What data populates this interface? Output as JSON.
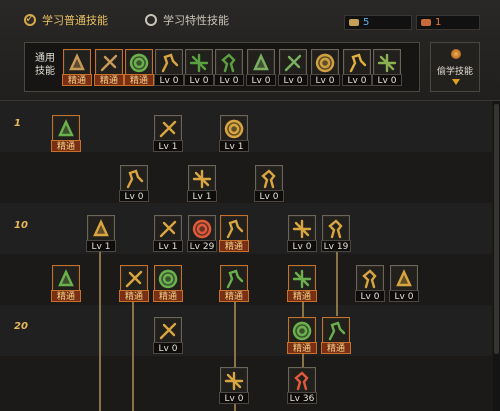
{
  "tabs": {
    "normal_label": "学习普通技能",
    "trait_label": "学习特性技能"
  },
  "counters": [
    {
      "value": "5",
      "color": "#5ab4e8",
      "icon_color": "#c4a05a",
      "icon": "sp-book-icon"
    },
    {
      "value": "1",
      "color": "#e87a3a",
      "icon_color": "#c86a3a",
      "icon": "tp-book-icon"
    }
  ],
  "general": {
    "label": "通用\n技能",
    "slots": [
      {
        "icon": "sit-icon",
        "tag": "精通",
        "mastered": true,
        "color": "#c89a58"
      },
      {
        "icon": "leap-icon",
        "tag": "精通",
        "mastered": true,
        "color": "#c89a58"
      },
      {
        "icon": "sprint-icon",
        "tag": "精通",
        "mastered": true,
        "color": "#6ab04c"
      },
      {
        "icon": "wings-icon",
        "tag": "Lv 0",
        "mastered": false,
        "color": "#d8a540"
      },
      {
        "icon": "target-icon",
        "tag": "Lv 0",
        "mastered": false,
        "color": "#5aa040"
      },
      {
        "icon": "crosshair-icon",
        "tag": "Lv 0",
        "mastered": false,
        "color": "#5aa040"
      },
      {
        "icon": "dash-icon",
        "tag": "Lv 0",
        "mastered": false,
        "color": "#7ab060"
      },
      {
        "icon": "kneel-icon",
        "tag": "Lv 0",
        "mastered": false,
        "color": "#7ab060"
      },
      {
        "icon": "ring-icon",
        "tag": "Lv 0",
        "mastered": false,
        "color": "#d0a040"
      },
      {
        "icon": "flex-icon",
        "tag": "Lv 0",
        "mastered": false,
        "color": "#e0b040"
      },
      {
        "icon": "stride-icon",
        "tag": "Lv 0",
        "mastered": false,
        "color": "#8ab050"
      }
    ]
  },
  "steal": {
    "label": "偷学技能"
  },
  "levels": [
    "1",
    "10",
    "20"
  ],
  "skills": [
    {
      "icon": "slash-icon",
      "tag": "精通",
      "mastered": true,
      "color": "#6ab04c"
    },
    {
      "icon": "blade-icon",
      "tag": "Lv 1",
      "mastered": false,
      "color": "#d8a540"
    },
    {
      "icon": "swing-icon",
      "tag": "Lv 1",
      "mastered": false,
      "color": "#d8a540"
    },
    {
      "icon": "spin-icon",
      "tag": "Lv 0",
      "mastered": false,
      "color": "#d8a540"
    },
    {
      "icon": "stance-icon",
      "tag": "Lv 1",
      "mastered": false,
      "color": "#d8a540"
    },
    {
      "icon": "burst-icon",
      "tag": "Lv 0",
      "mastered": false,
      "color": "#d8a540"
    },
    {
      "icon": "star-icon",
      "tag": "Lv 1",
      "mastered": false,
      "color": "#d8a540"
    },
    {
      "icon": "spear-icon",
      "tag": "Lv 1",
      "mastered": false,
      "color": "#d8a540"
    },
    {
      "icon": "guard-icon",
      "tag": "Lv 29",
      "mastered": false,
      "color": "#e05a3a"
    },
    {
      "icon": "rush-icon",
      "tag": "精通",
      "mastered": true,
      "color": "#d8a540"
    },
    {
      "icon": "crouch-icon",
      "tag": "Lv 0",
      "mastered": false,
      "color": "#d8a540"
    },
    {
      "icon": "bow-icon",
      "tag": "Lv 19",
      "mastered": false,
      "color": "#d8a540"
    },
    {
      "icon": "spark-icon",
      "tag": "精通",
      "mastered": true,
      "color": "#6ab04c"
    },
    {
      "icon": "fist-icon",
      "tag": "精通",
      "mastered": true,
      "color": "#d8a540"
    },
    {
      "icon": "wave-icon",
      "tag": "精通",
      "mastered": true,
      "color": "#6ab04c"
    },
    {
      "icon": "shatter-icon",
      "tag": "精通",
      "mastered": true,
      "color": "#6ab04c"
    },
    {
      "icon": "runner-icon",
      "tag": "精通",
      "mastered": true,
      "color": "#6ab04c"
    },
    {
      "icon": "fire-icon",
      "tag": "Lv 0",
      "mastered": false,
      "color": "#d8a540"
    },
    {
      "icon": "whirl-icon",
      "tag": "Lv 0",
      "mastered": false,
      "color": "#d8a540"
    },
    {
      "icon": "claw-icon",
      "tag": "Lv 0",
      "mastered": false,
      "color": "#d8a540"
    },
    {
      "icon": "nova-icon",
      "tag": "精通",
      "mastered": true,
      "color": "#6ab04c"
    },
    {
      "icon": "arc-icon",
      "tag": "精通",
      "mastered": true,
      "color": "#6ab04c"
    },
    {
      "icon": "storm-icon",
      "tag": "Lv 0",
      "mastered": false,
      "color": "#d8a540"
    },
    {
      "icon": "berserk-icon",
      "tag": "Lv 36",
      "mastered": false,
      "color": "#e05a3a"
    }
  ]
}
